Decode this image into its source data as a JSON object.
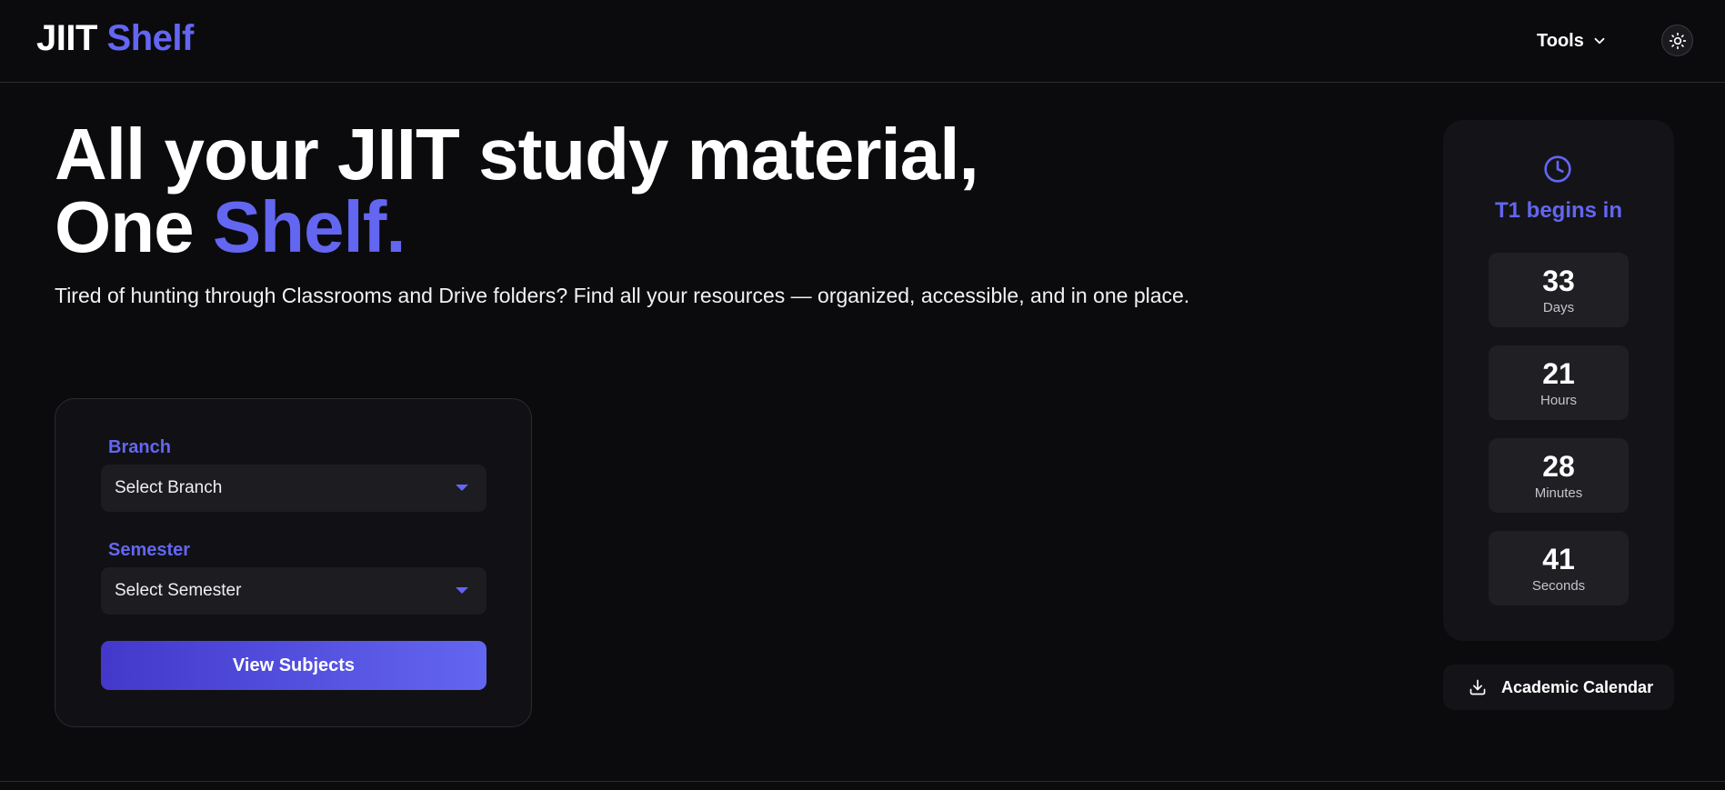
{
  "header": {
    "logo_part1": "JIIT",
    "logo_part2": "Shelf",
    "tools_label": "Tools",
    "theme_icon": "sun-icon"
  },
  "hero": {
    "title_line1": "All your JIIT study material,",
    "title_line2_prefix": "One ",
    "title_line2_accent": "Shelf.",
    "subtitle": "Tired of hunting through Classrooms and Drive folders? Find all your resources — organized, accessible, and in one place."
  },
  "form": {
    "branch_label": "Branch",
    "branch_value": "Select Branch",
    "semester_label": "Semester",
    "semester_value": "Select Semester",
    "submit_label": "View Subjects"
  },
  "countdown": {
    "icon": "clock-icon",
    "title": "T1 begins in",
    "units": [
      {
        "value": "33",
        "label": "Days"
      },
      {
        "value": "21",
        "label": "Hours"
      },
      {
        "value": "28",
        "label": "Minutes"
      },
      {
        "value": "41",
        "label": "Seconds"
      }
    ]
  },
  "calendar_button": {
    "icon": "download-icon",
    "label": "Academic Calendar"
  },
  "colors": {
    "background": "#0b0b0e",
    "accent": "#6366f1",
    "card": "#141418"
  }
}
